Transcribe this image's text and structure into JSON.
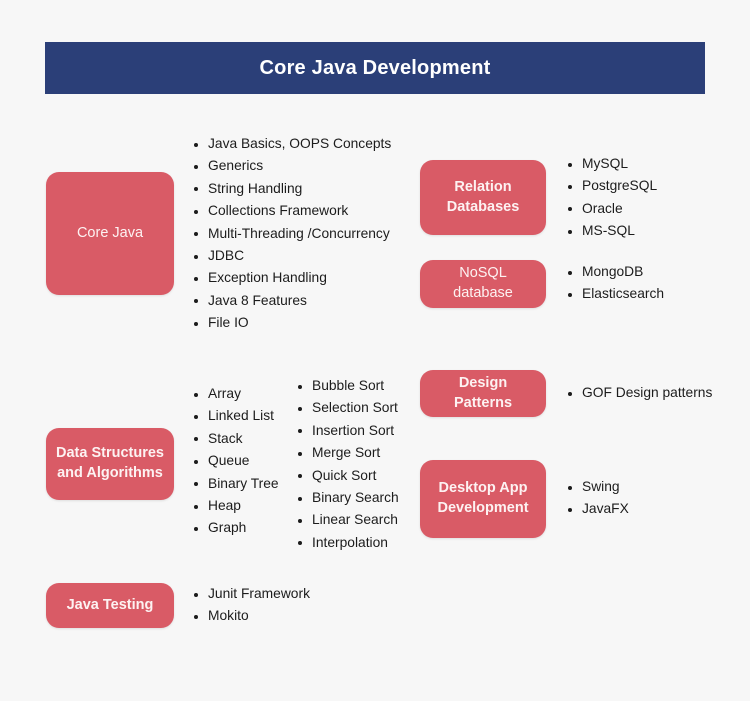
{
  "header": {
    "title": "Core Java Development",
    "background_color": "#2b3f78",
    "text_color": "#ffffff"
  },
  "theme": {
    "page_background": "#f7f7f7",
    "box_color": "#d95b66",
    "box_text_color": "#fdf2f2",
    "bullet_text_color": "#1c1c1c"
  },
  "sections": [
    {
      "id": "core-java",
      "box_label": "Core Java",
      "box_bold": false,
      "items": [
        " Java Basics, OOPS Concepts",
        "Generics",
        "String Handling",
        "Collections Framework",
        "Multi-Threading /Concurrency",
        "JDBC",
        "Exception Handling",
        "Java 8 Features",
        "File IO"
      ]
    },
    {
      "id": "data-structures",
      "box_label": "Data Structures and Algorithms",
      "box_label_line1": "Data Structures",
      "box_label_line2": "and Algorithms",
      "box_bold": true,
      "items": [
        "Array",
        "Linked List",
        "Stack",
        "Queue",
        "Binary Tree",
        "Heap",
        "Graph"
      ],
      "items_secondary": [
        "Bubble Sort",
        "Selection Sort",
        "Insertion Sort",
        "Merge Sort",
        "Quick Sort",
        "Binary Search",
        "Linear Search",
        "Interpolation"
      ]
    },
    {
      "id": "java-testing",
      "box_label": "Java Testing",
      "box_bold": true,
      "items": [
        "Junit Framework",
        "Mokito"
      ]
    },
    {
      "id": "relation-databases",
      "box_label": "Relation Databases",
      "box_label_line1": "Relation",
      "box_label_line2": "Databases",
      "box_bold": true,
      "items": [
        "MySQL",
        "PostgreSQL",
        "Oracle",
        "MS-SQL"
      ]
    },
    {
      "id": "nosql-database",
      "box_label": "NoSQL database",
      "box_bold": false,
      "items": [
        "MongoDB",
        "Elasticsearch"
      ]
    },
    {
      "id": "design-patterns",
      "box_label": "Design Patterns",
      "box_bold": true,
      "items": [
        "GOF Design patterns"
      ]
    },
    {
      "id": "desktop-app-development",
      "box_label": "Desktop App Development",
      "box_label_line1": "Desktop App",
      "box_label_line2": "Development",
      "box_bold": true,
      "items": [
        "Swing",
        "JavaFX"
      ]
    }
  ]
}
